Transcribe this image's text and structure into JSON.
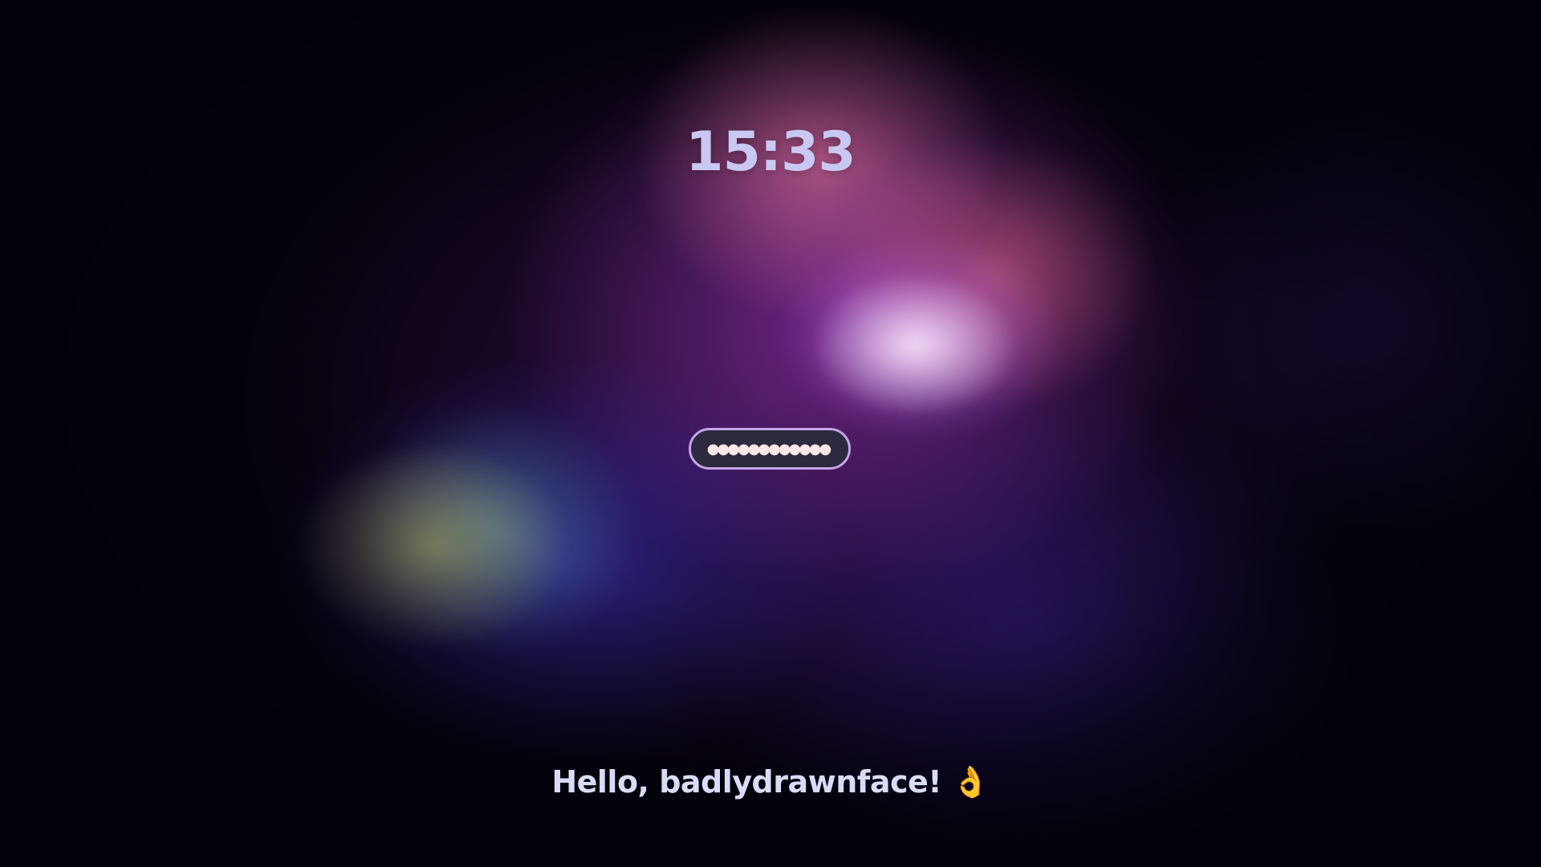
{
  "lockscreen": {
    "time": "15:33",
    "password_masked": "●●●●●●●●●●●●",
    "greeting": "Hello, badlydrawnface!",
    "greeting_emoji": "👌"
  },
  "colors": {
    "clock": "#c9c8f2",
    "input_border": "#c4a6e6",
    "input_background": "#2c2a3e",
    "input_text": "#fde6e6",
    "greeting": "#d8dcf8"
  },
  "icons": {
    "wallpaper": "nebula-wallpaper"
  }
}
